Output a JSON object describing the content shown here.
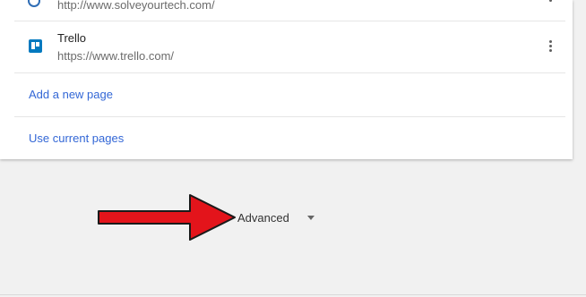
{
  "pages": [
    {
      "title": "",
      "url": "http://www.solveyourtech.com/",
      "icon": "solveyourtech-favicon-icon"
    },
    {
      "title": "Trello",
      "url": "https://www.trello.com/",
      "icon": "trello-icon"
    }
  ],
  "actions": {
    "add_new_page": "Add a new page",
    "use_current_pages": "Use current pages"
  },
  "advanced": {
    "label": "Advanced",
    "icon": "chevron-down-icon"
  },
  "annotation": {
    "icon": "red-arrow-icon",
    "color": "#e3141b"
  }
}
